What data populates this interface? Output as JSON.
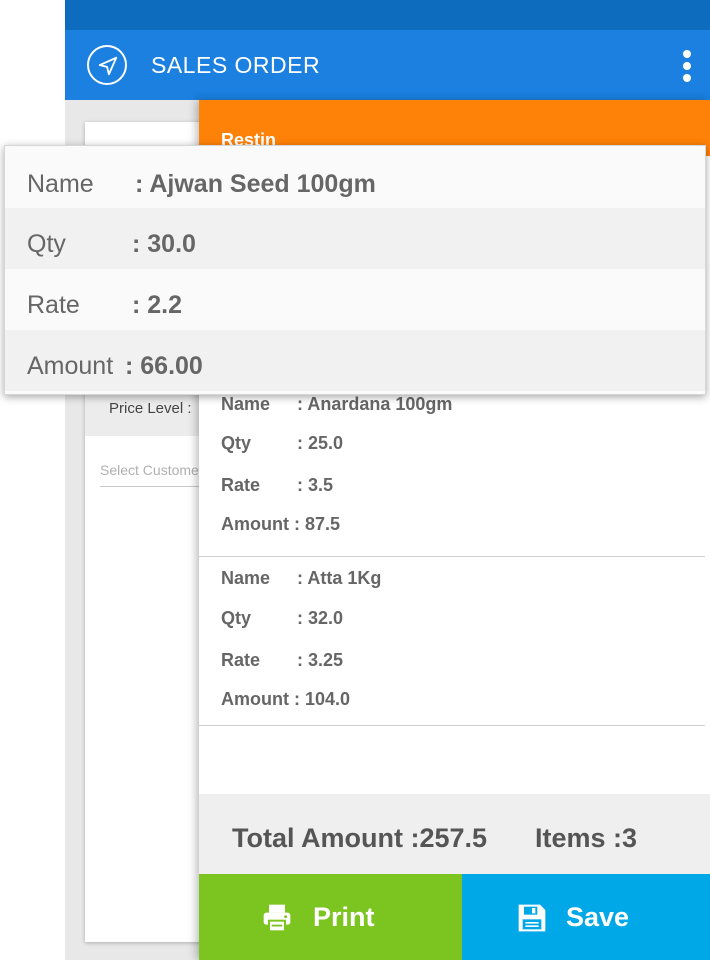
{
  "appbar": {
    "title": "SALES ORDER"
  },
  "background": {
    "price_level_label": "Price Level :",
    "customer_placeholder": "Select Customer"
  },
  "drawer": {
    "customer_name": "Restin",
    "items": [
      {
        "name_label": "Name",
        "name": ": Anardana 100gm",
        "qty_label": "Qty",
        "qty": ": 25.0",
        "rate_label": "Rate",
        "rate": ": 3.5",
        "amount_label": "Amount",
        "amount": ": 87.5"
      },
      {
        "name_label": "Name",
        "name": ": Atta 1Kg",
        "qty_label": "Qty",
        "qty": ": 32.0",
        "rate_label": "Rate",
        "rate": ": 3.25",
        "amount_label": "Amount",
        "amount": ": 104.0"
      }
    ],
    "total_amount": "Total Amount :257.5",
    "items_count": "Items :3",
    "print_label": "Print",
    "save_label": "Save"
  },
  "popup": {
    "name_label": "Name",
    "name": ": Ajwan Seed 100gm",
    "qty_label": "Qty",
    "qty": ": 30.0",
    "rate_label": "Rate",
    "rate": ": 2.2",
    "amount_label": "Amount",
    "amount": ": 66.00"
  },
  "colors": {
    "status_bar": "#0e6cbf",
    "app_bar": "#1b80e0",
    "drawer_header": "#ff8208",
    "print_button": "#7cc520",
    "save_button": "#00a8e8"
  },
  "icons": {
    "nav": "navigation-arrow-icon",
    "more": "more-vertical-icon",
    "print": "printer-icon",
    "save": "floppy-disk-icon"
  }
}
